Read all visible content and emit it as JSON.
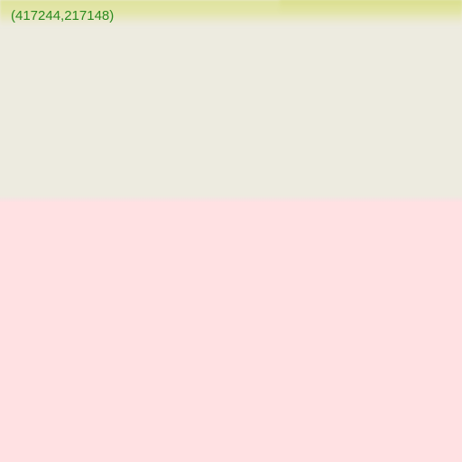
{
  "tile": {
    "coordinate_label": "(417244,217148)"
  },
  "colors": {
    "coordinate_text": "#2b8a1f",
    "land_area": "#edebe0",
    "water_or_zone_area": "#ffe1e3",
    "road_strip": "#e0e39f"
  }
}
